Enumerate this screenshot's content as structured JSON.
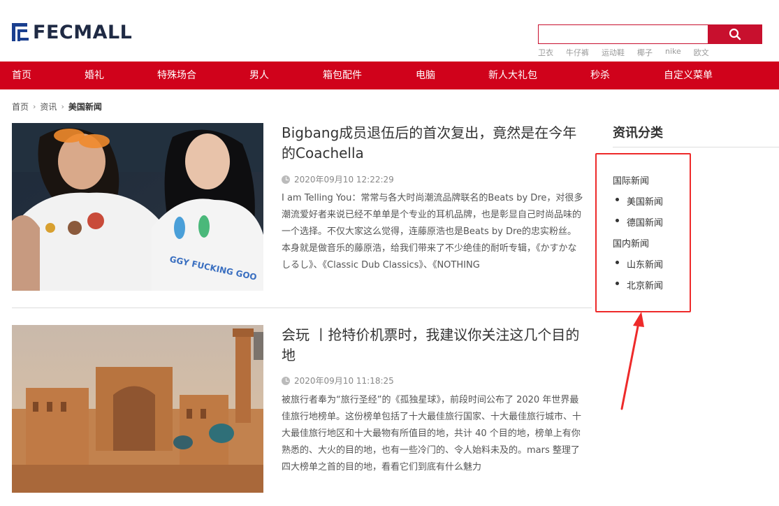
{
  "header": {
    "logo_text": "FECMALL",
    "search_placeholder": "",
    "hot_words": [
      "卫衣",
      "牛仔裤",
      "运动鞋",
      "椰子",
      "nike",
      "欧文"
    ]
  },
  "nav": {
    "items": [
      "首页",
      "婚礼",
      "特殊场合",
      "男人",
      "箱包配件",
      "电脑",
      "新人大礼包",
      "秒杀",
      "自定义菜单"
    ]
  },
  "breadcrumb": {
    "home": "首页",
    "section": "资讯",
    "current": "美国新闻"
  },
  "articles": [
    {
      "title": "Bigbang成员退伍后的首次复出，竟然是在今年的Coachella",
      "time": "2020年09月10 12:22:29",
      "summary": "I am Telling You：常常与各大时尚潮流品牌联名的Beats by Dre，对很多潮流爱好者来说已经不单单是个专业的耳机品牌，也是彰显自己时尚品味的一个选择。不仅大家这么觉得，连藤原浩也是Beats by Dre的忠实粉丝。本身就是做音乐的藤原浩，给我们带来了不少绝佳的耐听专辑，《かすかなしるし》、《Classic Dub Classics》、《NOTHING",
      "shirt_text": "GGY FUCKING GOO"
    },
    {
      "title": "会玩 丨抢特价机票时，我建议你关注这几个目的地",
      "time": "2020年09月10 11:18:25",
      "summary": "被旅行者奉为“旅行圣经”的《孤独星球》，前段时间公布了 2020 年世界最佳旅行地榜单。这份榜单包括了十大最佳旅行国家、十大最佳旅行城市、十大最佳旅行地区和十大最物有所值目的地，共计 40 个目的地，榜单上有你熟悉的、大火的目的地，也有一些冷门的、令人始料未及的。mars 整理了四大榜单之首的目的地，看看它们到底有什么魅力"
    }
  ],
  "sidebar": {
    "title": "资讯分类",
    "groups": [
      {
        "label": "国际新闻",
        "items": [
          "美国新闻",
          "德国新闻"
        ]
      },
      {
        "label": "国内新闻",
        "items": [
          "山东新闻",
          "北京新闻"
        ]
      }
    ]
  },
  "colors": {
    "brand_red": "#d0021b",
    "annotation_red": "#ee2a2a",
    "logo_blue": "#1a3f8f"
  }
}
